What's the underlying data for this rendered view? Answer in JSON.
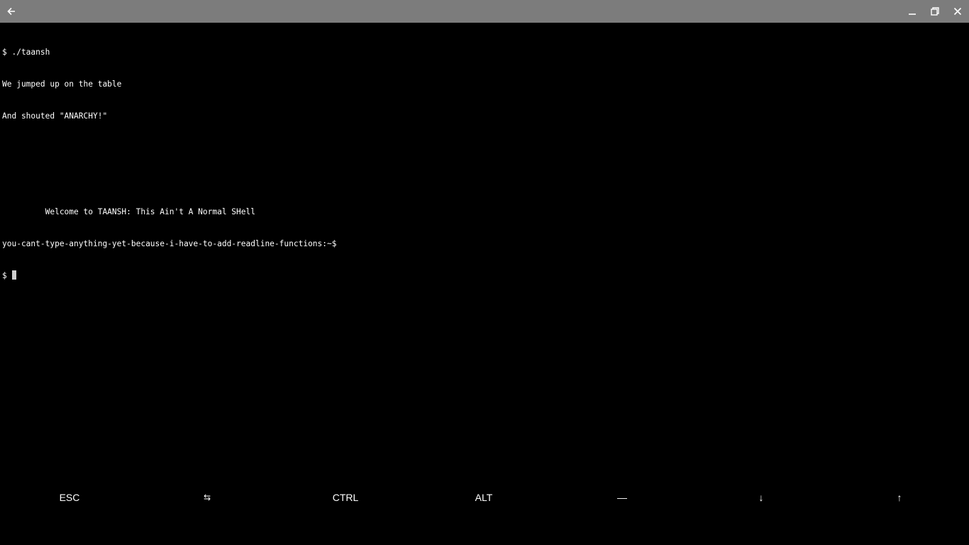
{
  "titlebar": {
    "background": "#7c7c7c",
    "icons": [
      "back-arrow-icon",
      "minimize-icon",
      "restore-icon",
      "close-icon"
    ]
  },
  "terminal": {
    "lines": [
      "$ ./taansh",
      "We jumped up on the table",
      "And shouted \"ANARCHY!\"",
      "",
      "",
      "         Welcome to TAANSH: This Ain't A Normal SHell",
      "you-cant-type-anything-yet-because-i-have-to-add-readline-functions:~$"
    ],
    "prompt": "$ ",
    "text_color": "#ffffff",
    "background": "#000000"
  },
  "extra_keys": {
    "esc": "ESC",
    "tab": "⇆",
    "ctrl": "CTRL",
    "alt": "ALT",
    "dash": "—",
    "down": "↓",
    "up": "↑"
  }
}
